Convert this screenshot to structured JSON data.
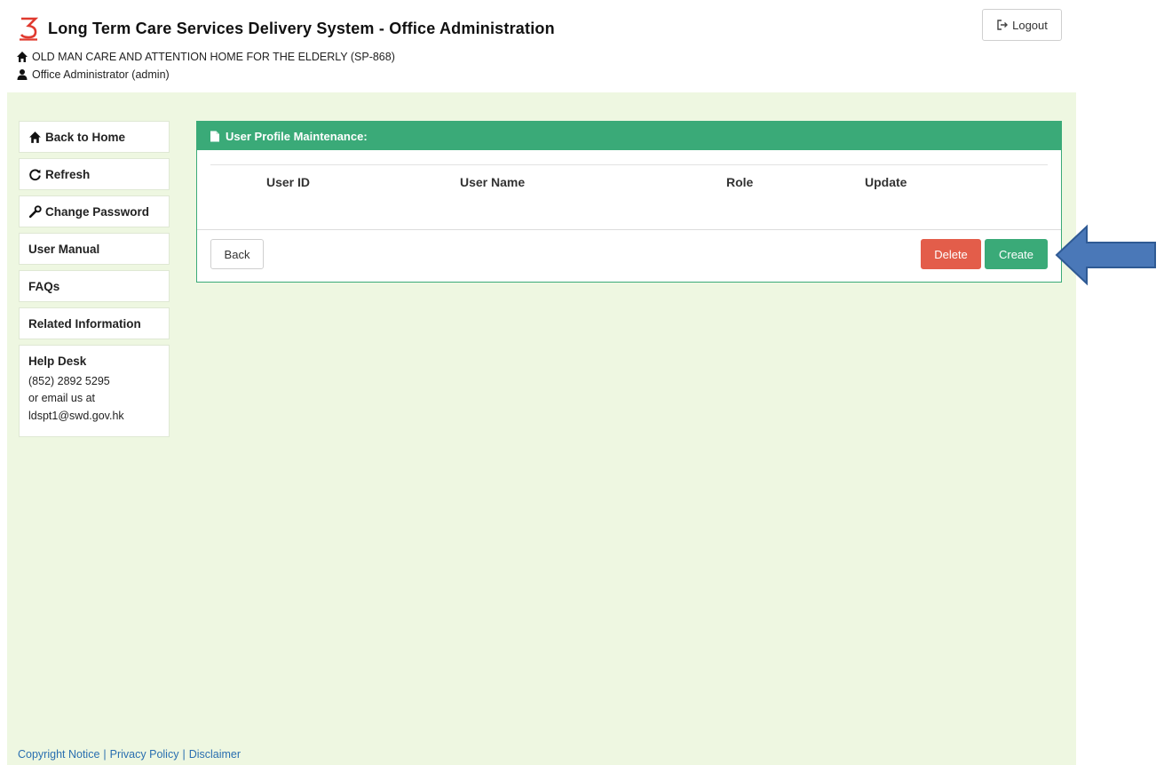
{
  "header": {
    "app_title": "Long Term Care Services Delivery System - Office Administration",
    "organization": "OLD MAN CARE AND ATTENTION HOME FOR THE ELDERLY (SP-868)",
    "user_role": "Office Administrator (admin)",
    "logout_label": "Logout"
  },
  "sidebar": {
    "items": [
      {
        "label": "Back to Home",
        "icon": "home-icon"
      },
      {
        "label": "Refresh",
        "icon": "refresh-icon"
      },
      {
        "label": "Change Password",
        "icon": "wrench-icon"
      },
      {
        "label": "User Manual"
      },
      {
        "label": "FAQs"
      },
      {
        "label": "Related Information"
      }
    ],
    "helpdesk": {
      "title": "Help Desk",
      "phone": "(852) 2892 5295",
      "email_prefix": "or email us at",
      "email": "ldspt1@swd.gov.hk"
    }
  },
  "panel": {
    "title": "User Profile Maintenance:",
    "columns": [
      "User ID",
      "User Name",
      "Role",
      "Update"
    ],
    "rows": [],
    "back_label": "Back",
    "delete_label": "Delete",
    "create_label": "Create"
  },
  "footer": {
    "links": [
      "Copyright Notice",
      "Privacy Policy",
      "Disclaimer"
    ],
    "separator": "|"
  },
  "colors": {
    "accent_green": "#3aaa78",
    "delete_red": "#e35d4a",
    "page_background": "#eef7e1",
    "arrow_blue": "#4a78b8"
  }
}
